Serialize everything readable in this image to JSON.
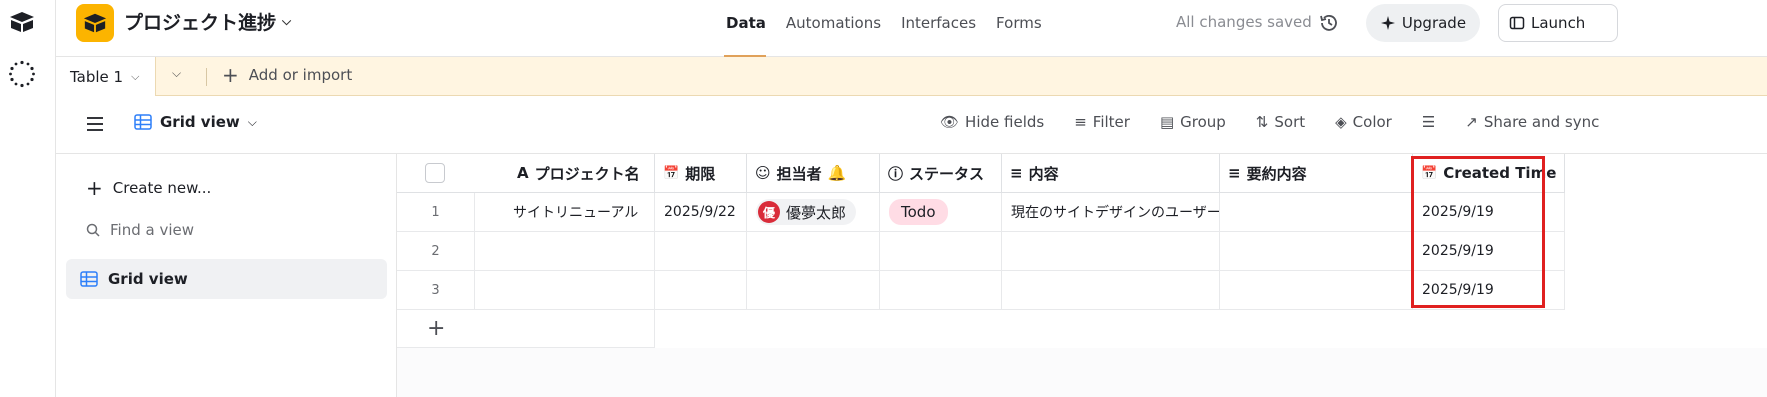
{
  "header": {
    "base_title": "プロジェクト進捗",
    "nav": [
      "Data",
      "Automations",
      "Interfaces",
      "Forms"
    ],
    "saved_status": "All changes saved",
    "upgrade_label": "Upgrade",
    "launch_label": "Launch"
  },
  "tabs": {
    "active_table": "Table 1",
    "add_import": "Add or import"
  },
  "viewbar": {
    "view_name": "Grid view",
    "tools": [
      "Hide fields",
      "Filter",
      "Group",
      "Sort",
      "Color",
      "Share and sync"
    ]
  },
  "sidebar": {
    "create_new": "Create new...",
    "find_view": "Find a view",
    "views": [
      "Grid view"
    ]
  },
  "table": {
    "columns": [
      "プロジェクト名",
      "期限",
      "担当者",
      "ステータス",
      "内容",
      "要約内容",
      "Created Time"
    ],
    "rows": [
      {
        "num": "1",
        "name": "サイトリニューアル",
        "due": "2025/9/22",
        "assignee_initial": "優",
        "assignee": "優夢太郎",
        "status": "Todo",
        "content": "現在のサイトデザインのユーザー…",
        "summary": "",
        "created": "2025/9/19"
      },
      {
        "num": "2",
        "name": "",
        "due": "",
        "assignee_initial": "",
        "assignee": "",
        "status": "",
        "content": "",
        "summary": "",
        "created": "2025/9/19"
      },
      {
        "num": "3",
        "name": "",
        "due": "",
        "assignee_initial": "",
        "assignee": "",
        "status": "",
        "content": "",
        "summary": "",
        "created": "2025/9/19"
      }
    ],
    "add_row": "+"
  },
  "colors": {
    "accent": "#fcb400",
    "tabbar_bg": "#fff5e1",
    "status_todo": "#ffdce5",
    "highlight": "#e02020"
  }
}
